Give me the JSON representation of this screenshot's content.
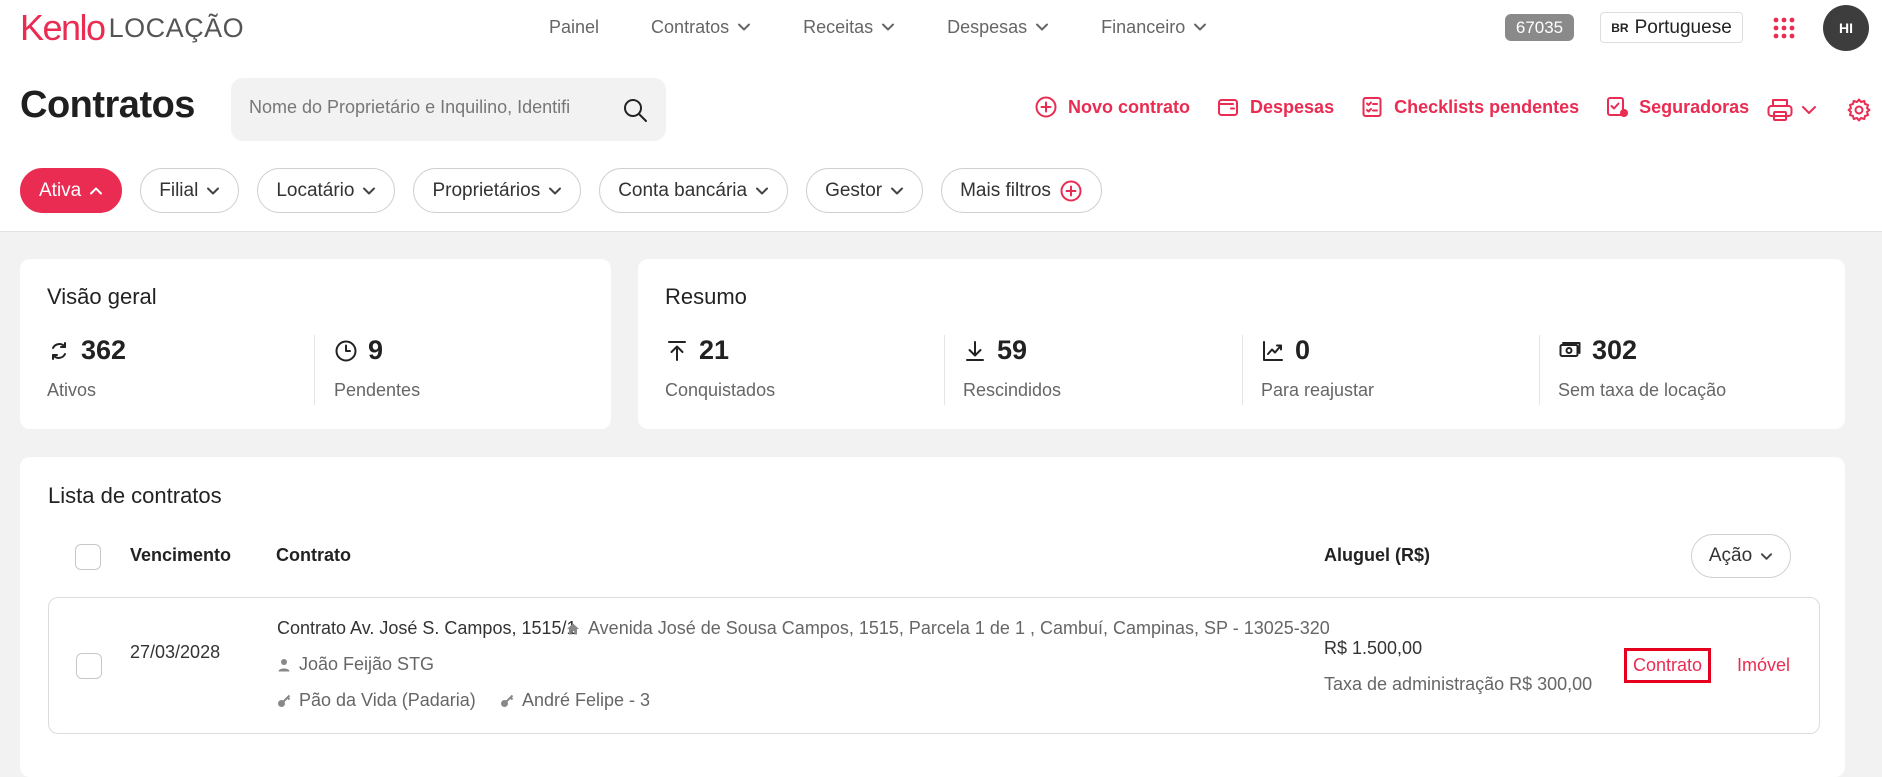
{
  "header": {
    "logo_brand": "Kenlo",
    "logo_sub": "LOCAÇÃO",
    "nav": [
      {
        "label": "Painel",
        "dropdown": false
      },
      {
        "label": "Contratos",
        "dropdown": true
      },
      {
        "label": "Receitas",
        "dropdown": true
      },
      {
        "label": "Despesas",
        "dropdown": true
      },
      {
        "label": "Financeiro",
        "dropdown": true
      }
    ],
    "account_id": "67035",
    "language_code": "BR",
    "language_label": "Portuguese",
    "avatar_initials": "HI"
  },
  "page": {
    "title": "Contratos",
    "search_placeholder": "Nome do Proprietário e Inquilino, Identifi",
    "actions": [
      {
        "label": "Novo contrato",
        "icon": "plus-circle-icon"
      },
      {
        "label": "Despesas",
        "icon": "wallet-icon"
      },
      {
        "label": "Checklists pendentes",
        "icon": "checklist-icon"
      },
      {
        "label": "Seguradoras",
        "icon": "insurance-icon"
      }
    ]
  },
  "filters": [
    {
      "label": "Ativa",
      "active": true
    },
    {
      "label": "Filial",
      "active": false
    },
    {
      "label": "Locatário",
      "active": false
    },
    {
      "label": "Proprietários",
      "active": false
    },
    {
      "label": "Conta bancária",
      "active": false
    },
    {
      "label": "Gestor",
      "active": false
    },
    {
      "label": "Mais filtros",
      "active": false
    }
  ],
  "overview": {
    "title": "Visão geral",
    "stats": [
      {
        "value": "362",
        "label": "Ativos",
        "icon": "refresh-icon"
      },
      {
        "value": "9",
        "label": "Pendentes",
        "icon": "clock-icon"
      }
    ]
  },
  "summary": {
    "title": "Resumo",
    "stats": [
      {
        "value": "21",
        "label": "Conquistados",
        "icon": "arrow-up-bar-icon"
      },
      {
        "value": "59",
        "label": "Rescindidos",
        "icon": "download-icon"
      },
      {
        "value": "0",
        "label": "Para reajustar",
        "icon": "trend-up-icon"
      },
      {
        "value": "302",
        "label": "Sem taxa de locação",
        "icon": "cash-icon"
      }
    ]
  },
  "list": {
    "title": "Lista de contratos",
    "columns": {
      "due": "Vencimento",
      "contract": "Contrato",
      "rent": "Aluguel (R$)"
    },
    "action_label": "Ação",
    "rows": [
      {
        "due_date": "27/03/2028",
        "contract_name": "Contrato Av. José S. Campos, 1515/1",
        "address": "Avenida José de Sousa Campos, 1515, Parcela 1 de 1 , Cambuí, Campinas, SP - 13025-320",
        "tenant": "João Feijão STG",
        "owner_1": "Pão da Vida (Padaria)",
        "owner_2": "André Felipe - 3",
        "rent": "R$ 1.500,00",
        "admin_fee": "Taxa de administração R$ 300,00",
        "link_contract": "Contrato",
        "link_property": "Imóvel"
      }
    ]
  },
  "colors": {
    "accent": "#ea2c52",
    "highlight": "#e5001f"
  }
}
